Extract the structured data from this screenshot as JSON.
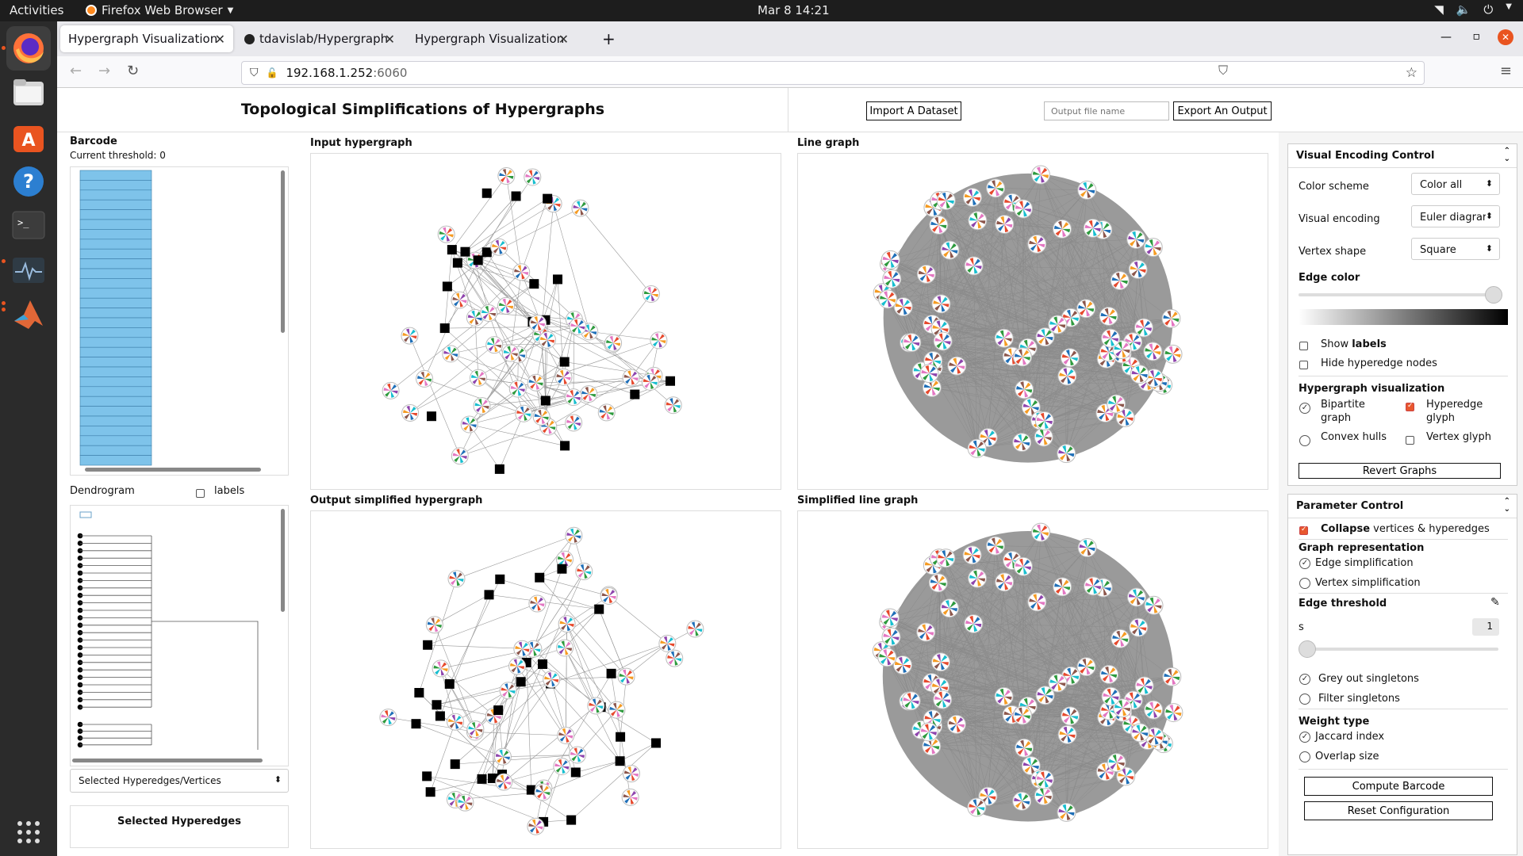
{
  "os": {
    "activities": "Activities",
    "app_name": "Firefox Web Browser",
    "clock": "Mar 8  14:21"
  },
  "browser": {
    "tabs": [
      {
        "label": "Hypergraph Visualization"
      },
      {
        "label": "tdavislab/Hypergraph-Vis"
      },
      {
        "label": "Hypergraph Visualization"
      }
    ],
    "url_host": "192.168.1.252",
    "url_port": ":6060"
  },
  "page": {
    "title": "Topological Simplifications of Hypergraphs",
    "import_button": "Import A Dataset",
    "output_placeholder": "Output file name",
    "export_button": "Export An Output",
    "barcode": {
      "title": "Barcode",
      "threshold": "Current threshold: 0",
      "bars": 30
    },
    "dendrogram": {
      "title": "Dendrogram",
      "labels": "labels"
    },
    "selected_dropdown": "Selected Hyperedges/Vertices",
    "selected_title": "Selected Hyperedges",
    "input_hypergraph": "Input hypergraph",
    "line_graph": "Line graph",
    "output_hypergraph": "Output simplified hypergraph",
    "simplified_line_graph": "Simplified line graph"
  },
  "visual_encoding": {
    "title": "Visual Encoding Control",
    "color_scheme_label": "Color scheme",
    "color_scheme_value": "Color all",
    "visual_encoding_label": "Visual encoding",
    "visual_encoding_value": "Euler diagrar",
    "vertex_shape_label": "Vertex shape",
    "vertex_shape_value": "Square",
    "edge_color_label": "Edge color",
    "show_labels_prefix": "Show ",
    "show_labels_bold": "labels",
    "hide_hyperedge_nodes": "Hide hyperedge nodes",
    "hypergraph_vis_title": "Hypergraph visualization",
    "bipartite_1": "Bipartite",
    "bipartite_2": "graph",
    "hyperedge_glyph_1": "Hyperedge",
    "hyperedge_glyph_2": "glyph",
    "convex_hulls": "Convex hulls",
    "vertex_glyph": "Vertex glyph",
    "revert_button": "Revert Graphs"
  },
  "parameter_control": {
    "title": "Parameter Control",
    "collapse_bold": "Collapse",
    "collapse_rest": " vertices & hyperedges",
    "graph_rep_title": "Graph representation",
    "edge_simplification": "Edge simplification",
    "vertex_simplification": "Vertex simplification",
    "edge_threshold_title": "Edge threshold",
    "s_label": "s",
    "s_value": "1",
    "grey_out_singletons": "Grey out singletons",
    "filter_singletons": "Filter singletons",
    "weight_type_title": "Weight type",
    "jaccard": "Jaccard index",
    "overlap": "Overlap size",
    "compute_button": "Compute Barcode",
    "reset_button": "Reset Configuration"
  },
  "colors": {
    "bar_fill": "#7ec3ea",
    "accent": "#e8572e",
    "glyph_palette": [
      "#e6492d",
      "#f59b23",
      "#2e9a3e",
      "#1f6fb8",
      "#8e44ad",
      "#e377c2",
      "#8c564b",
      "#17becf"
    ]
  }
}
